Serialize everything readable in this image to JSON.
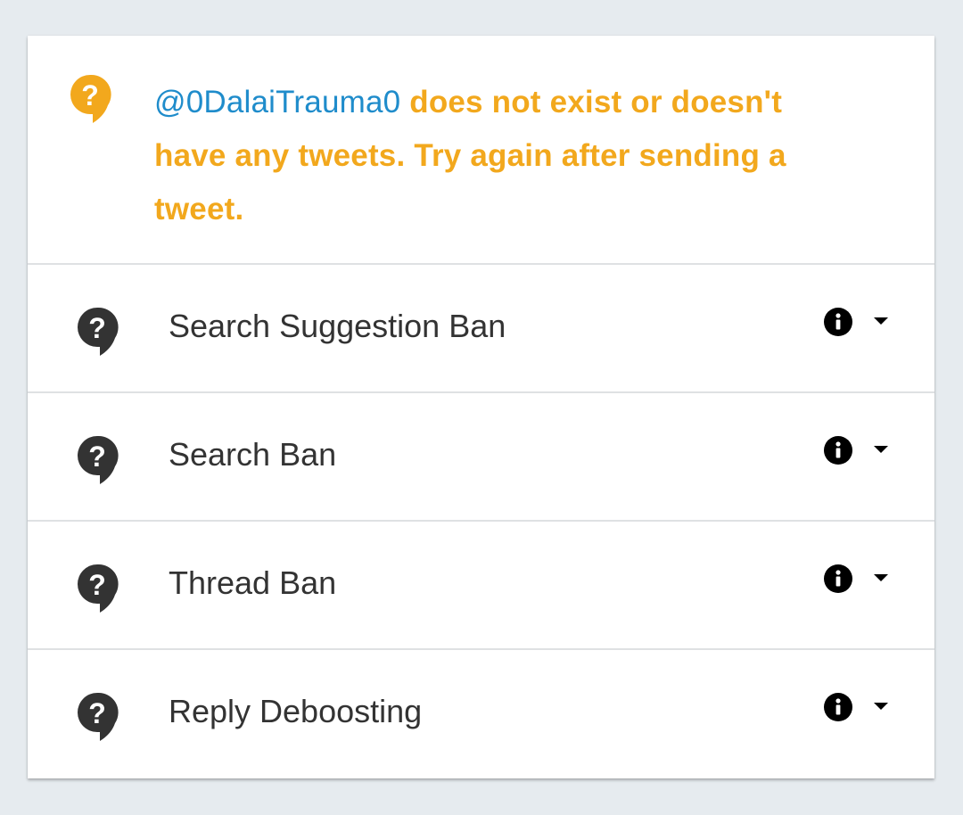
{
  "status": {
    "handle": "@0DalaiTrauma0",
    "message": " does not exist or doesn't have any tweets. Try again after sending a tweet.",
    "icon": "question-bubble-icon",
    "color": "#f2a81d",
    "handle_color": "#1f8ccb"
  },
  "checks": [
    {
      "label": "Search Suggestion Ban",
      "icon": "question-bubble-icon"
    },
    {
      "label": "Search Ban",
      "icon": "question-bubble-icon"
    },
    {
      "label": "Thread Ban",
      "icon": "question-bubble-icon"
    },
    {
      "label": "Reply Deboosting",
      "icon": "question-bubble-icon"
    }
  ]
}
